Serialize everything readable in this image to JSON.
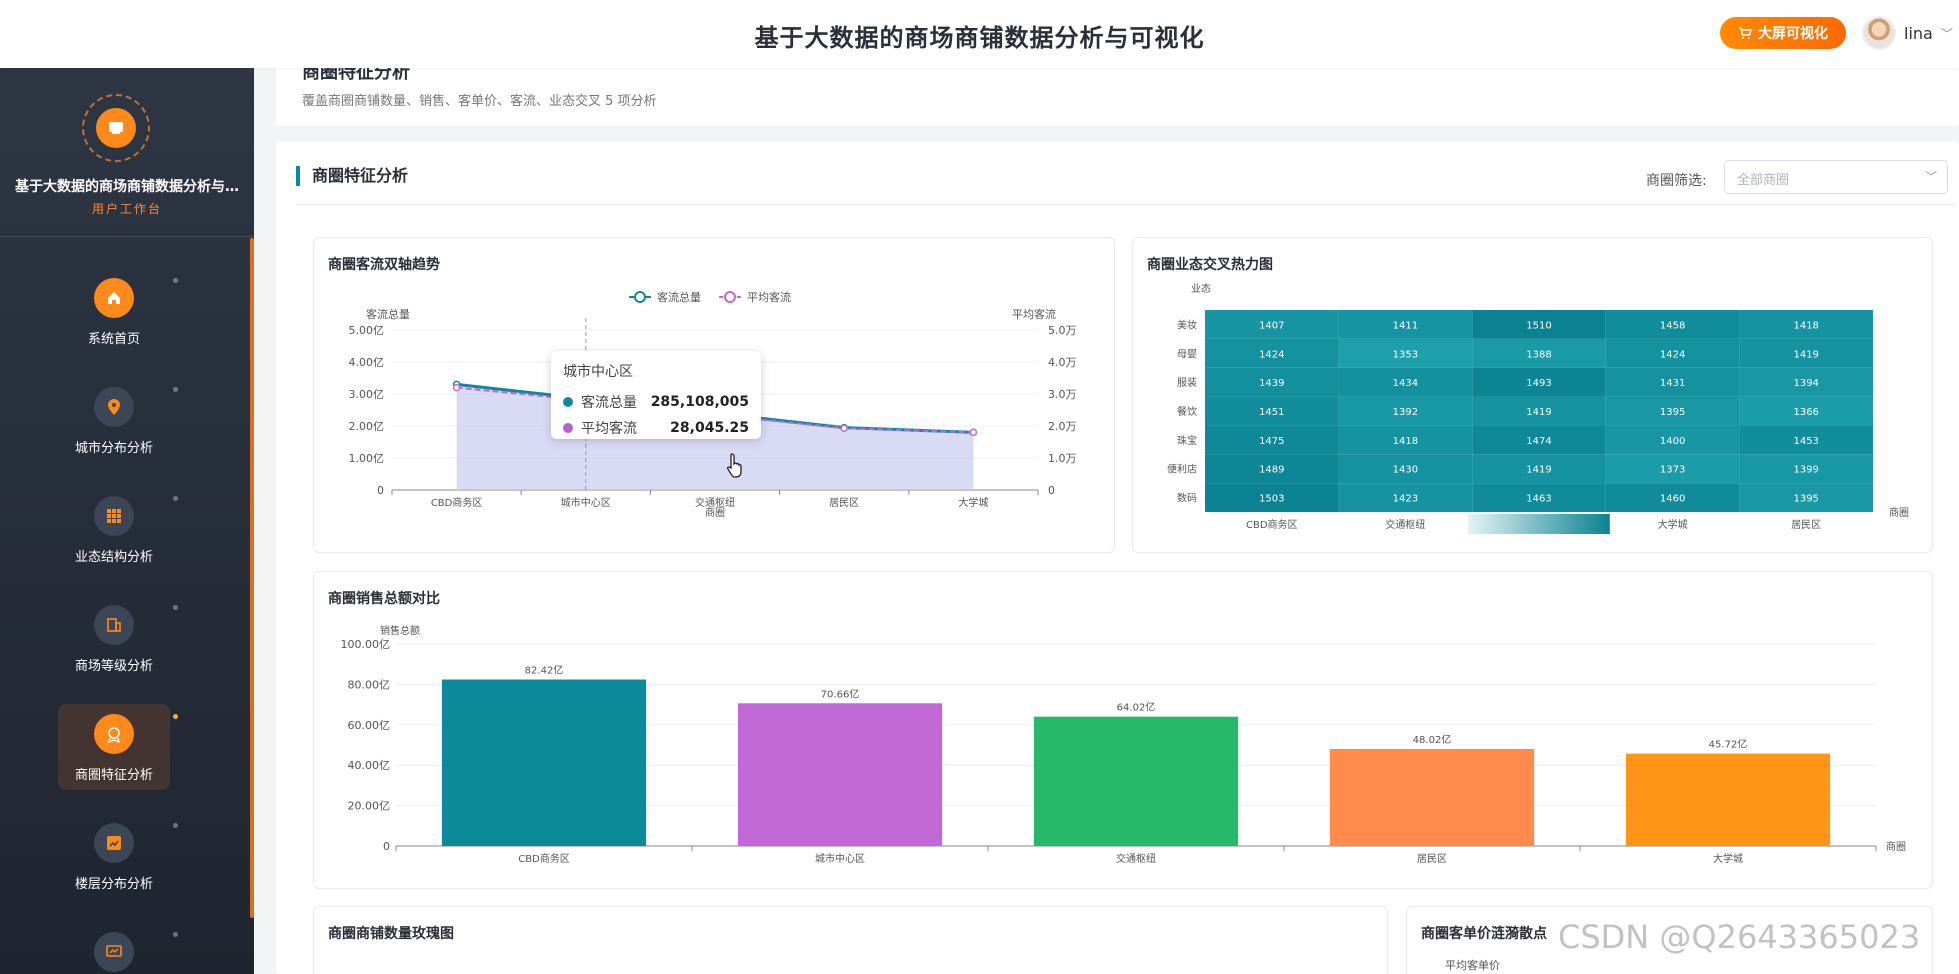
{
  "header": {
    "title": "基于大数据的商场商铺数据分析与可视化",
    "bigscreen_label": "大屏可视化",
    "user_name": "lina"
  },
  "sidebar": {
    "app_name": "基于大数据的商场商铺数据分析与…",
    "sub": "用户工作台",
    "items": [
      {
        "label": "系统首页",
        "icon": "home-icon"
      },
      {
        "label": "城市分布分析",
        "icon": "location-pin-icon"
      },
      {
        "label": "业态结构分析",
        "icon": "grid-icon"
      },
      {
        "label": "商场等级分析",
        "icon": "building-icon"
      },
      {
        "label": "商圈特征分析",
        "icon": "badge-icon"
      },
      {
        "label": "楼层分布分析",
        "icon": "chart-icon"
      }
    ]
  },
  "page": {
    "title": "商圈特征分析",
    "desc": "覆盖商圈商铺数量、销售、客单价、客流、业态交叉 5 项分析"
  },
  "section": {
    "title": "商圈特征分析",
    "filter_label": "商圈筛选:",
    "filter_placeholder": "全部商圈"
  },
  "cards": {
    "traffic": "商圈客流双轴趋势",
    "heatmap": "商圈业态交叉热力图",
    "sales": "商圈销售总额对比",
    "rose": "商圈商铺数量玫瑰图",
    "scatter": "商圈客单价涟漪散点",
    "scatter_ylabel": "平均客单价"
  },
  "tooltip": {
    "title": "城市中心区",
    "rows": [
      {
        "name": "客流总量",
        "value": "285,108,005",
        "color": "#0d8a9a"
      },
      {
        "name": "平均客流",
        "value": "28,045.25",
        "color": "#b45fd0"
      }
    ]
  },
  "watermark": "CSDN @Q2643365023",
  "chart_data": [
    {
      "type": "line",
      "title": "商圈客流双轴趋势",
      "categories": [
        "CBD商务区",
        "城市中心区",
        "交通枢纽",
        "居民区",
        "大学城"
      ],
      "xlabel": "商圈",
      "ylabel": "客流总量",
      "y2label": "平均客流",
      "ylim": [
        0,
        5
      ],
      "y2lim": [
        0,
        5
      ],
      "yticks": [
        "0",
        "1.00亿",
        "2.00亿",
        "3.00亿",
        "4.00亿",
        "5.00亿"
      ],
      "y2ticks": [
        "0",
        "1.0万",
        "2.0万",
        "3.0万",
        "4.0万",
        "5.0万"
      ],
      "legend": "top-center",
      "series": [
        {
          "name": "客流总量",
          "values": [
            3.3,
            2.85,
            2.4,
            1.95,
            1.8
          ],
          "color": "#0d8a9a",
          "unit": "亿"
        },
        {
          "name": "平均客流",
          "values": [
            3.2,
            2.8,
            2.35,
            1.93,
            1.8
          ],
          "color": "#c069d6",
          "unit": "万"
        }
      ]
    },
    {
      "type": "heatmap",
      "title": "商圈业态交叉热力图",
      "ylabel": "业态",
      "xlabel": "商圈",
      "x": [
        "CBD商务区",
        "交通枢纽",
        "",
        "大学城",
        "居民区"
      ],
      "y": [
        "美妆",
        "母婴",
        "服装",
        "餐饮",
        "珠宝",
        "便利店",
        "数码"
      ],
      "values": [
        [
          1407,
          1411,
          1510,
          1458,
          1418
        ],
        [
          1424,
          1353,
          1388,
          1424,
          1419
        ],
        [
          1439,
          1434,
          1493,
          1431,
          1394
        ],
        [
          1451,
          1392,
          1419,
          1395,
          1366
        ],
        [
          1475,
          1418,
          1474,
          1400,
          1453
        ],
        [
          1489,
          1430,
          1419,
          1373,
          1399
        ],
        [
          1503,
          1423,
          1463,
          1460,
          1395
        ]
      ]
    },
    {
      "type": "bar",
      "title": "商圈销售总额对比",
      "categories": [
        "CBD商务区",
        "城市中心区",
        "交通枢纽",
        "居民区",
        "大学城"
      ],
      "values": [
        82.42,
        70.66,
        64.02,
        48.02,
        45.72
      ],
      "labels": [
        "82.42亿",
        "70.66亿",
        "64.02亿",
        "48.02亿",
        "45.72亿"
      ],
      "colors": [
        "#0d8a9a",
        "#c069d6",
        "#26b96a",
        "#ff8a4c",
        "#ff9418"
      ],
      "ylabel": "销售总额",
      "xlabel": "商圈",
      "ylim": [
        0,
        100
      ],
      "yticks": [
        "0",
        "20.00亿",
        "40.00亿",
        "60.00亿",
        "80.00亿",
        "100.00亿"
      ]
    }
  ]
}
